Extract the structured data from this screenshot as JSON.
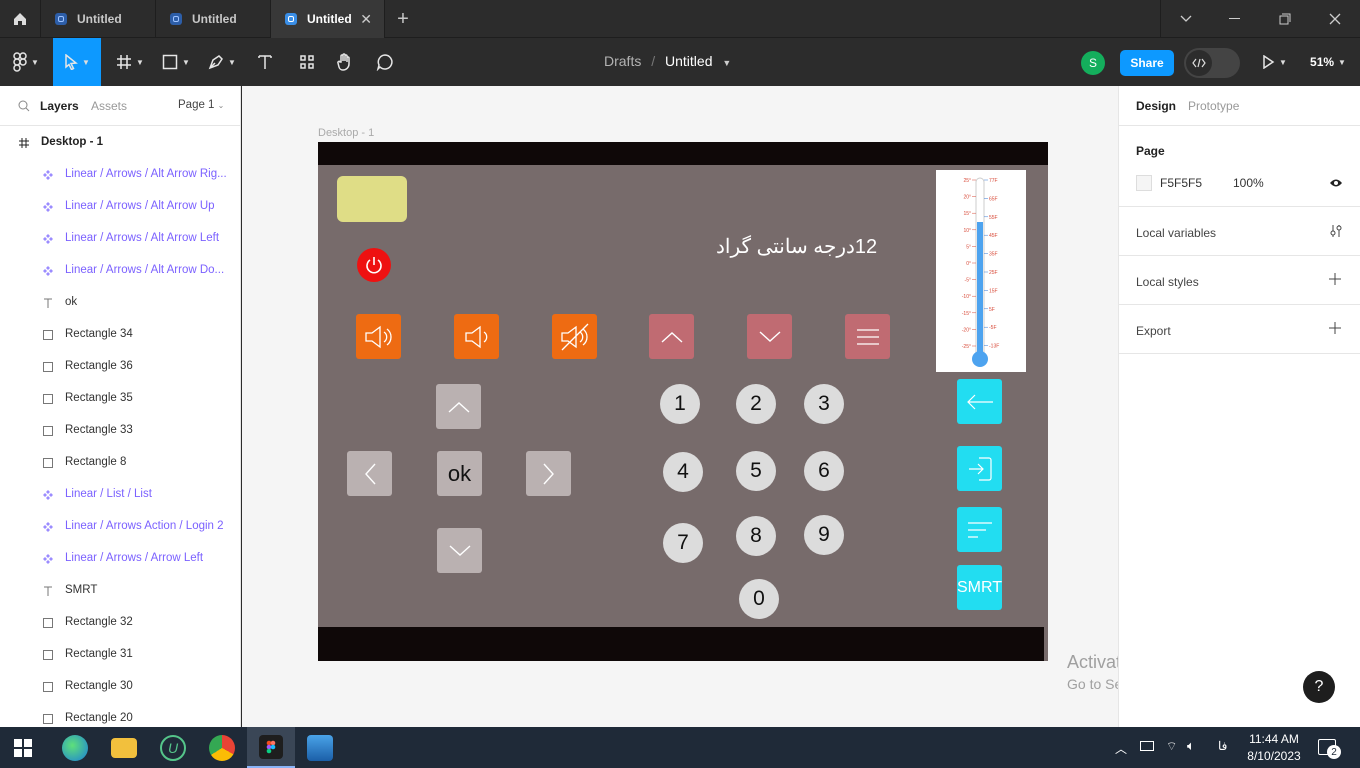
{
  "tabs": [
    {
      "label": "Untitled"
    },
    {
      "label": "Untitled"
    },
    {
      "label": "Untitled"
    }
  ],
  "header": {
    "breadcrumb_root": "Drafts",
    "separator": "/",
    "file_name": "Untitled",
    "avatar_initial": "S",
    "share_label": "Share",
    "zoom": "51%"
  },
  "left_panel": {
    "tabs": [
      "Layers",
      "Assets"
    ],
    "page_selector": "Page 1",
    "frame_name": "Desktop - 1",
    "layers": [
      {
        "name": "Linear / Arrows / Alt Arrow Rig...",
        "kind": "component"
      },
      {
        "name": "Linear / Arrows / Alt Arrow Up",
        "kind": "component"
      },
      {
        "name": "Linear / Arrows / Alt Arrow Left",
        "kind": "component"
      },
      {
        "name": "Linear / Arrows / Alt Arrow Do...",
        "kind": "component"
      },
      {
        "name": "ok",
        "kind": "text"
      },
      {
        "name": "Rectangle 34",
        "kind": "rect"
      },
      {
        "name": "Rectangle 36",
        "kind": "rect"
      },
      {
        "name": "Rectangle 35",
        "kind": "rect"
      },
      {
        "name": "Rectangle 33",
        "kind": "rect"
      },
      {
        "name": "Rectangle 8",
        "kind": "rect"
      },
      {
        "name": "Linear / List / List",
        "kind": "component"
      },
      {
        "name": "Linear / Arrows Action / Login 2",
        "kind": "component"
      },
      {
        "name": "Linear / Arrows / Arrow Left",
        "kind": "component"
      },
      {
        "name": "SMRT",
        "kind": "text"
      },
      {
        "name": "Rectangle 32",
        "kind": "rect"
      },
      {
        "name": "Rectangle 31",
        "kind": "rect"
      },
      {
        "name": "Rectangle 30",
        "kind": "rect"
      },
      {
        "name": "Rectangle 20",
        "kind": "rect"
      }
    ]
  },
  "right_panel": {
    "tabs": [
      "Design",
      "Prototype"
    ],
    "page_title": "Page",
    "page_color": "F5F5F5",
    "page_opacity": "100%",
    "local_variables": "Local variables",
    "local_styles": "Local styles",
    "export": "Export"
  },
  "canvas": {
    "frame_label": "Desktop - 1",
    "temperature_text": "12درجه سانتی گراد",
    "ok_label": "ok",
    "smrt_label": "SMRT",
    "numbers": [
      "1",
      "2",
      "3",
      "4",
      "5",
      "6",
      "7",
      "8",
      "9",
      "0"
    ],
    "thermo_c": [
      "25°",
      "20°",
      "15°",
      "10°",
      "5°",
      "0°",
      "-5°",
      "-10°",
      "-15°",
      "-20°",
      "-25°"
    ],
    "thermo_f": [
      "77F",
      "65F",
      "55F",
      "45F",
      "35F",
      "25F",
      "15F",
      "5F",
      "-5F",
      "-13F"
    ],
    "colors": {
      "frame_bg": "#776b6b",
      "orange": "#ee6b12",
      "rose": "#c06b72",
      "cyan": "#22ddf1",
      "yellow": "#dfdd86",
      "power_red": "#ee1111"
    }
  },
  "watermark": {
    "title": "Activate Windows",
    "subtitle": "Go to Settings to activate Windows."
  },
  "help_label": "?",
  "taskbar": {
    "lang": "فا",
    "time": "11:44 AM",
    "date": "8/10/2023",
    "notification_count": "2"
  }
}
